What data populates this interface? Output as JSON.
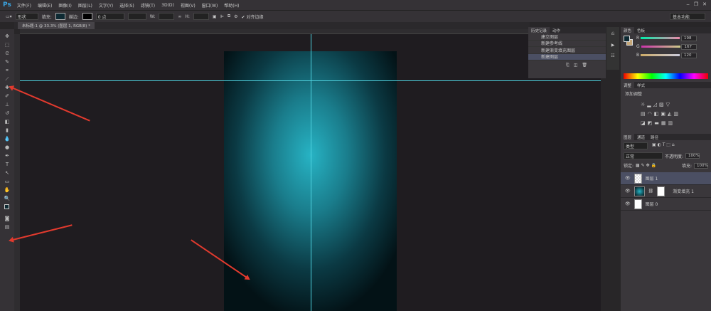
{
  "app": {
    "logo": "Ps",
    "menu": [
      "文件(F)",
      "编辑(E)",
      "图像(I)",
      "图层(L)",
      "文字(Y)",
      "选择(S)",
      "滤镜(T)",
      "3D(D)",
      "视图(V)",
      "窗口(W)",
      "帮助(H)"
    ]
  },
  "options": {
    "mode": "形状",
    "fill_label": "填充:",
    "stroke_label": "描边:",
    "stroke_width": "0 点",
    "w_label": "W:",
    "h_label": "H:",
    "align_edges": "对齐边缘",
    "workspace": "基本功能"
  },
  "document": {
    "tab": "未标题-1 @ 33.3% (图层 1, RGB/8) *",
    "gradient_center": "#27b3c4",
    "gradient_edge": "#031216",
    "guide_color": "#4fd3e0"
  },
  "history": {
    "tabs": [
      "历史记录",
      "动作"
    ],
    "items": [
      "建立图层",
      "新建参考线",
      "新建渐变填充图层",
      "新建图层"
    ],
    "selected": 3
  },
  "color": {
    "tabs": [
      "颜色",
      "色板"
    ],
    "r": "198",
    "g": "167",
    "b": "120",
    "foreground": "#0e2a33",
    "background": "#c6a778"
  },
  "adjustments": {
    "tabs": [
      "调整",
      "样式"
    ],
    "title": "添加调整"
  },
  "layers": {
    "tabs": [
      "图层",
      "通道",
      "路径"
    ],
    "filter": "类型",
    "blend": "正常",
    "opacity_label": "不透明度:",
    "opacity": "100%",
    "lock_label": "锁定:",
    "fill_label": "填充:",
    "fill": "100%",
    "items": [
      {
        "name": "图层 1",
        "selected": true
      },
      {
        "name": "渐变填充 1",
        "selected": false
      },
      {
        "name": "图层 0",
        "selected": false
      }
    ]
  },
  "annotation_color": "#e23a2e"
}
